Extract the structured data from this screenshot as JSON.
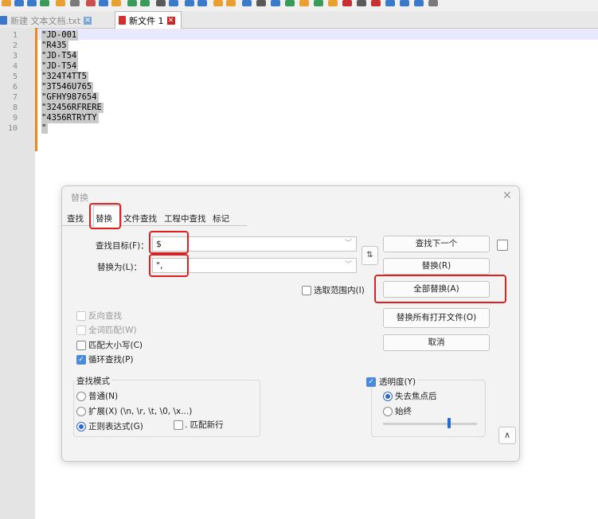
{
  "tabs": [
    {
      "label": "新建 文本文档.txt"
    },
    {
      "label": "新文件 1"
    }
  ],
  "editor": {
    "line_numbers": [
      "1",
      "2",
      "3",
      "4",
      "5",
      "6",
      "7",
      "8",
      "9",
      "10"
    ],
    "lines": [
      "\"JD-001",
      "\"R435",
      "\"JD-T54",
      "\"JD-T54",
      "\"324T4TT5",
      "\"3T546U765",
      "\"GFHY987654",
      "\"32456RFRERE",
      "\"4356RTRYTY",
      "\""
    ]
  },
  "dialog": {
    "title": "替换",
    "tabs": [
      "查找",
      "替换",
      "文件查找",
      "工程中查找",
      "标记"
    ],
    "find_label": "查找目标(F)：",
    "find_value": "$",
    "replace_label": "替换为(L)：",
    "replace_value": "\",",
    "swap_symbol": "⇅",
    "in_selection": "选取范围内(I)",
    "buttons": {
      "find_next": "查找下一个",
      "replace": "替换(R)",
      "replace_all": "全部替换(A)",
      "replace_all_open": "替换所有打开文件(O)",
      "cancel": "取消"
    },
    "options": {
      "backward": "反向查找",
      "whole_word": "全词匹配(W)",
      "match_case": "匹配大小写(C)",
      "wrap": "循环查找(P)"
    },
    "search_mode": {
      "title": "查找模式",
      "normal": "普通(N)",
      "extended": "扩展(X) (\\n, \\r, \\t, \\0, \\x...)",
      "regex": "正则表达式(G)",
      "dot_newline": ". 匹配新行"
    },
    "transparency": {
      "label": "透明度(Y)",
      "on_lose_focus": "失去焦点后",
      "always": "始终",
      "level": 0.7
    }
  }
}
